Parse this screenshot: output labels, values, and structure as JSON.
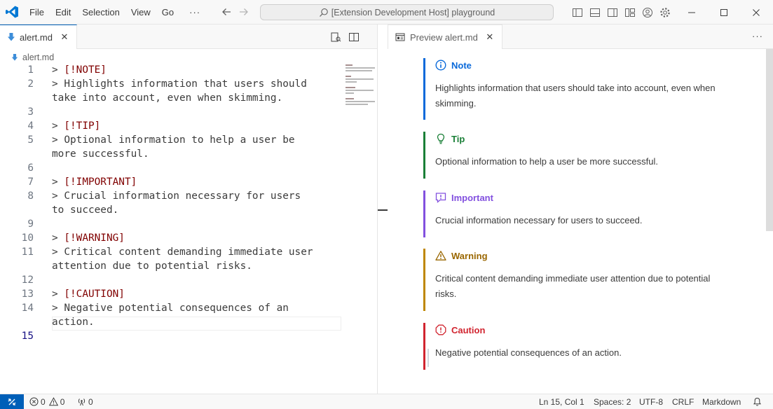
{
  "titlebar": {
    "menu": [
      "File",
      "Edit",
      "Selection",
      "View",
      "Go",
      "···"
    ],
    "command_center": "[Extension Development Host] playground"
  },
  "left_editor": {
    "tab_label": "alert.md",
    "tab_close": "✕",
    "breadcrumb": "alert.md",
    "lines": [
      {
        "n": "1",
        "q": "> ",
        "tag": "[!NOTE]",
        "rest": ""
      },
      {
        "n": "2",
        "q": "> ",
        "tag": "",
        "rest": "Highlights information that users should"
      },
      {
        "n": "",
        "q": "",
        "tag": "",
        "rest": "take into account, even when skimming."
      },
      {
        "n": "3",
        "q": "",
        "tag": "",
        "rest": ""
      },
      {
        "n": "4",
        "q": "> ",
        "tag": "[!TIP]",
        "rest": ""
      },
      {
        "n": "5",
        "q": "> ",
        "tag": "",
        "rest": "Optional information to help a user be"
      },
      {
        "n": "",
        "q": "",
        "tag": "",
        "rest": "more successful."
      },
      {
        "n": "6",
        "q": "",
        "tag": "",
        "rest": ""
      },
      {
        "n": "7",
        "q": "> ",
        "tag": "[!IMPORTANT]",
        "rest": ""
      },
      {
        "n": "8",
        "q": "> ",
        "tag": "",
        "rest": "Crucial information necessary for users"
      },
      {
        "n": "",
        "q": "",
        "tag": "",
        "rest": "to succeed."
      },
      {
        "n": "9",
        "q": "",
        "tag": "",
        "rest": ""
      },
      {
        "n": "10",
        "q": "> ",
        "tag": "[!WARNING]",
        "rest": ""
      },
      {
        "n": "11",
        "q": "> ",
        "tag": "",
        "rest": "Critical content demanding immediate user"
      },
      {
        "n": "",
        "q": "",
        "tag": "",
        "rest": "attention due to potential risks."
      },
      {
        "n": "12",
        "q": "",
        "tag": "",
        "rest": ""
      },
      {
        "n": "13",
        "q": "> ",
        "tag": "[!CAUTION]",
        "rest": ""
      },
      {
        "n": "14",
        "q": "> ",
        "tag": "",
        "rest": "Negative potential consequences of an"
      },
      {
        "n": "",
        "q": "",
        "tag": "",
        "rest": "action."
      },
      {
        "n": "15",
        "q": "",
        "tag": "",
        "rest": ""
      }
    ]
  },
  "preview": {
    "tab_label": "Preview alert.md",
    "tab_close": "✕",
    "more": "···",
    "alerts": {
      "note": {
        "title": "Note",
        "body": "Highlights information that users should take into account, even when skimming."
      },
      "tip": {
        "title": "Tip",
        "body": "Optional information to help a user be more successful."
      },
      "important": {
        "title": "Important",
        "body": "Crucial information necessary for users to succeed."
      },
      "warning": {
        "title": "Warning",
        "body": "Critical content demanding immediate user attention due to potential risks."
      },
      "caution": {
        "title": "Caution",
        "body": "Negative potential consequences of an action."
      }
    }
  },
  "statusbar": {
    "errors": "0",
    "warnings": "0",
    "ports": "0",
    "position": "Ln 15, Col 1",
    "spaces": "Spaces: 2",
    "encoding": "UTF-8",
    "eol": "CRLF",
    "language": "Markdown"
  },
  "colors": {
    "accent": "#005fb8",
    "note": "#0969da",
    "tip": "#1a7f37",
    "important": "#8250df",
    "warning": "#9a6700",
    "caution": "#d1242f",
    "md_tag": "#800000"
  },
  "icons": [
    "vscode-logo-icon",
    "search-icon",
    "arrow-left-icon",
    "arrow-right-icon",
    "toggle-sidebar-icon",
    "toggle-panel-icon",
    "toggle-secondary-sidebar-icon",
    "customize-layout-icon",
    "account-icon",
    "gear-icon",
    "minimize-icon",
    "maximize-icon",
    "close-icon",
    "markdown-file-icon",
    "open-preview-icon",
    "split-editor-icon",
    "preview-icon",
    "info-icon",
    "lightbulb-icon",
    "report-icon",
    "warning-icon",
    "error-icon",
    "remote-icon",
    "bell-icon",
    "broadcast-icon"
  ]
}
